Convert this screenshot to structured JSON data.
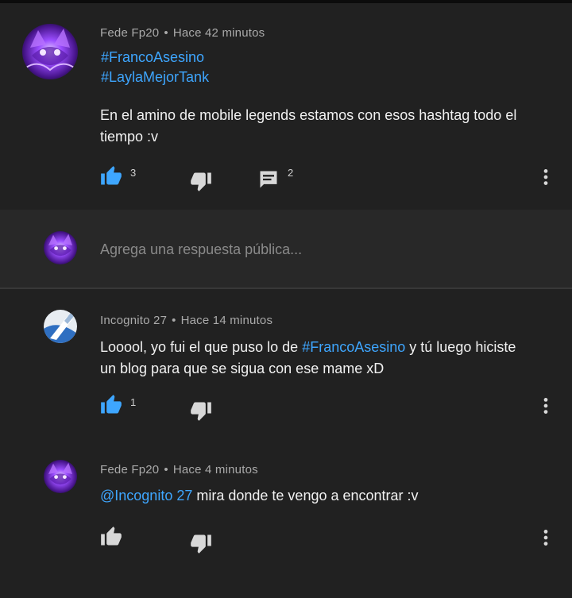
{
  "comment": {
    "author": "Fede Fp20",
    "separator": "•",
    "time": "Hace 42 minutos",
    "hashtags": [
      "#FrancoAsesino",
      "#LaylaMejorTank"
    ],
    "text_line1": "En el amino de mobile legends estamos con esos hashtag todo el",
    "text_line2": "tiempo :v",
    "likes": "3",
    "replies_count": "2",
    "like_icon": "thumb-up-icon",
    "dislike_icon": "thumb-down-icon",
    "reply_icon": "comment-icon",
    "menu_icon": "more-vert-icon"
  },
  "reply_input": {
    "placeholder": "Agrega una respuesta pública..."
  },
  "replies": [
    {
      "author": "Incognito 27",
      "separator": "•",
      "time": "Hace 14 minutos",
      "text_before": "Looool, yo fui el que puso lo de ",
      "hashtag": "#FrancoAsesino",
      "text_after": " y tú luego hiciste",
      "text_line2": "un blog para que se sigua con ese mame xD",
      "likes": "1"
    },
    {
      "author": "Fede Fp20",
      "separator": "•",
      "time": "Hace 4 minutos",
      "mention": "@Incognito 27",
      "text_after": " mira donde te vengo a encontrar :v"
    }
  ],
  "colors": {
    "accent": "#3ea6ff",
    "background": "#212121",
    "reply_box_bg": "#282828",
    "muted_text": "#aaaaaa",
    "icon_inactive": "#d8d8d8"
  }
}
